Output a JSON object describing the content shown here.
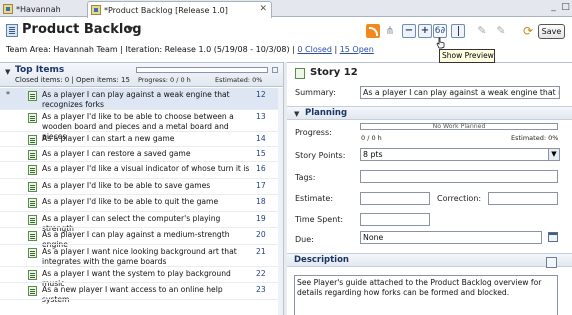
{
  "tabs": [
    {
      "label": "*Havannah"
    },
    {
      "label": "*Product Backlog [Release 1.0]"
    }
  ],
  "header": {
    "title": "Product Backlog",
    "team_area_label": "Team Area: Havannah Team | Iteration: Release 1.0 (5/19/08 - 10/3/08) |",
    "closed_link": "0 Closed",
    "separator": "|",
    "open_link": "15 Open",
    "save_label": "Save",
    "tooltip": "Show Preview"
  },
  "left": {
    "heading": "Top Items",
    "subheading": "Closed items: 0 | Open items: 15",
    "progress_label": "Progress: 0 / 0 h",
    "estimated_label": "Estimated: 0%",
    "items": [
      {
        "marker": "*",
        "text": "As a player I can play against a weak engine that recognizes forks",
        "num": "12"
      },
      {
        "marker": "",
        "text": "As a player I'd like to be able to choose between a wooden board and pieces and a metal board and pieces",
        "num": "13"
      },
      {
        "marker": "",
        "text": "As a player I can start a new game",
        "num": "14"
      },
      {
        "marker": "",
        "text": "As a player I can restore a saved game",
        "num": "15"
      },
      {
        "marker": "",
        "text": "As a player I'd like a visual indicator of whose turn it is",
        "num": "16"
      },
      {
        "marker": "",
        "text": "As a player I'd like to be able to save games",
        "num": "17"
      },
      {
        "marker": "",
        "text": "As a player I'd like to be able to quit the game",
        "num": "18"
      },
      {
        "marker": "",
        "text": "As a player I can select the computer's playing strength",
        "num": "19"
      },
      {
        "marker": "",
        "text": "As a player I can play against a medium-strength engine",
        "num": "20"
      },
      {
        "marker": "",
        "text": "As a player I want nice looking background art that integrates with the game boards",
        "num": "21"
      },
      {
        "marker": "",
        "text": "As a player I want the system to play background music",
        "num": "22"
      },
      {
        "marker": "",
        "text": "As a new player I want access to an online help system",
        "num": "23"
      }
    ]
  },
  "right": {
    "story_title": "Story 12",
    "summary_label": "Summary:",
    "summary_value": "As a player I can play against a weak engine that recognizes forks",
    "planning_heading": "Planning",
    "progress_label": "Progress:",
    "progress_bar_text": "No Work Planned",
    "progress_sub": "0 / 0 h",
    "estimated_sub": "Estimated: 0%",
    "story_points_label": "Story Points:",
    "story_points_value": "8 pts",
    "tags_label": "Tags:",
    "tags_value": "",
    "estimate_label": "Estimate:",
    "estimate_value": "",
    "correction_label": "Correction:",
    "correction_value": "",
    "time_spent_label": "Time Spent:",
    "time_spent_value": "",
    "due_label": "Due:",
    "due_value": "None",
    "description_heading": "Description",
    "description_text": "See Player's guide attached to the Product Backlog overview for details regarding how forks can be formed and blocked."
  }
}
